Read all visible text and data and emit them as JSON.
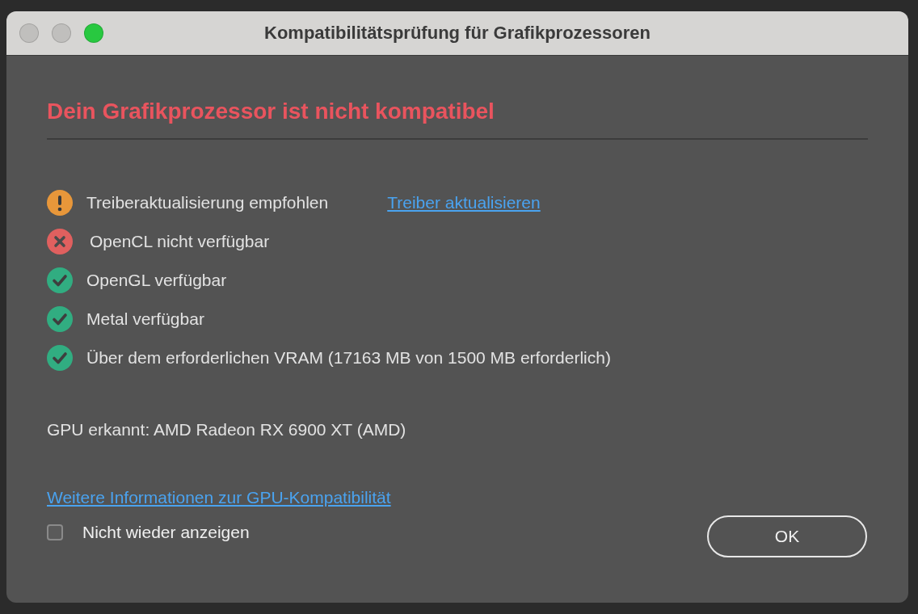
{
  "window": {
    "title": "Kompatibilitätsprüfung für Grafikprozessoren",
    "controls": [
      {
        "color": "#c0bfbd"
      },
      {
        "color": "#c0bfbd"
      },
      {
        "color": "#28c840"
      }
    ]
  },
  "heading": "Dein Grafikprozessor ist nicht kompatibel",
  "checks": [
    {
      "kind": "warning",
      "text": "Treiberaktualisierung empfohlen",
      "link": "Treiber aktualisieren"
    },
    {
      "kind": "error",
      "text": "OpenCL nicht verfügbar"
    },
    {
      "kind": "ok",
      "text": "OpenGL verfügbar"
    },
    {
      "kind": "ok",
      "text": "Metal verfügbar"
    },
    {
      "kind": "ok",
      "text": "Über dem erforderlichen VRAM (17163 MB von 1500 MB erforderlich)"
    }
  ],
  "gpu": "GPU erkannt: AMD Radeon RX 6900 XT (AMD)",
  "info_link": "Weitere Informationen zur GPU-Kompatibilität",
  "dont_show": {
    "label": "Nicht wieder anzeigen",
    "checked": false
  },
  "buttons": [
    "OK"
  ]
}
